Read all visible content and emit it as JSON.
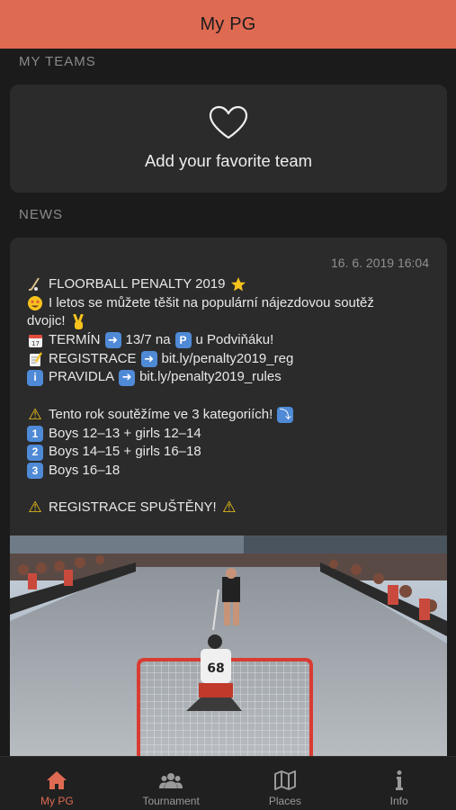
{
  "header": {
    "title": "My PG"
  },
  "sections": {
    "my_teams": "MY TEAMS",
    "news": "NEWS"
  },
  "favorite": {
    "label": "Add your favorite team"
  },
  "news": {
    "date": "16. 6. 2019 16:04",
    "lines": {
      "l1": "FLOORBALL PENALTY 2019",
      "l2": "I letos se můžete těšit na populární nájezdovou soutěž",
      "l3": "dvojic!",
      "l4a": "TERMÍN",
      "l4b": "13/7 na",
      "l4c": "u Podviňáku!",
      "l5a": "REGISTRACE",
      "l5b": "bit.ly/penalty2019_reg",
      "l6a": "PRAVIDLA",
      "l6b": "bit.ly/penalty2019_rules",
      "l7": "Tento rok soutěžíme ve 3 kategoriích!",
      "l8": "Boys 12–13 + girls 12–14",
      "l9": "Boys 14–15 + girls 16–18",
      "l10": "Boys 16–18",
      "l11": "REGISTRACE SPUŠTĚNY!"
    },
    "photo_jersey_number": "68"
  },
  "tabs": [
    {
      "label": "My PG",
      "icon": "home-icon",
      "active": true
    },
    {
      "label": "Tournament",
      "icon": "people-icon",
      "active": false
    },
    {
      "label": "Places",
      "icon": "map-icon",
      "active": false
    },
    {
      "label": "Info",
      "icon": "info-icon",
      "active": false
    }
  ],
  "colors": {
    "accent": "#df6a52",
    "background": "#1b1b1b",
    "card": "#2b2b2b"
  }
}
